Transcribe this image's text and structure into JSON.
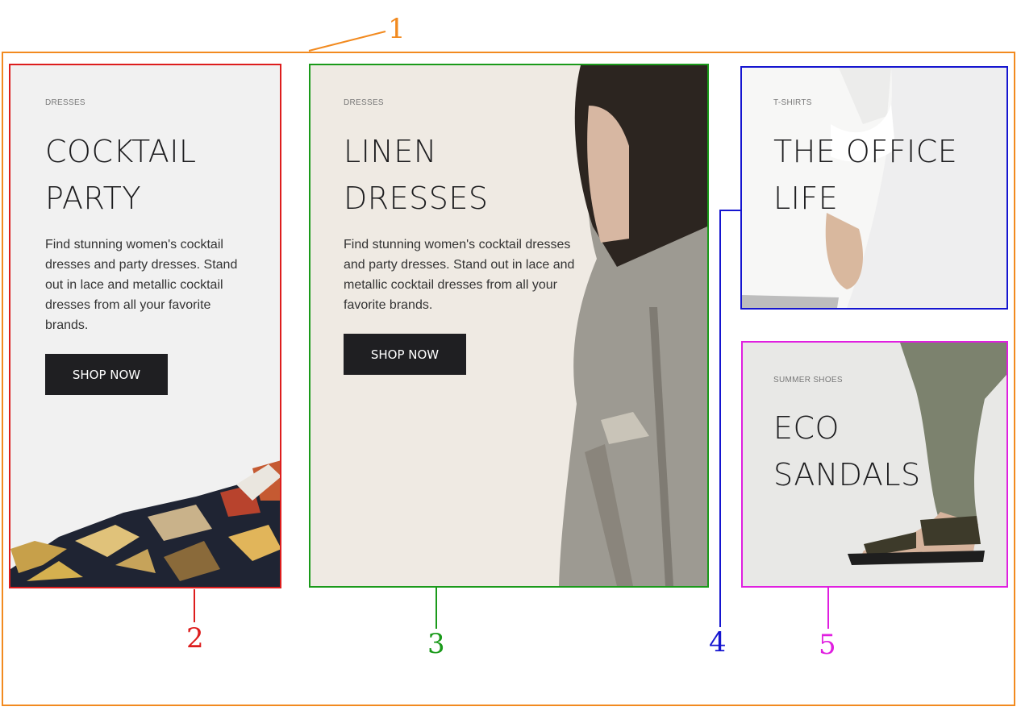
{
  "cards": [
    {
      "category": "DRESSES",
      "title_line1": "COCKTAIL",
      "title_line2": "PARTY",
      "description": "Find stunning women's cocktail dresses and party dresses. Stand out in lace and metallic cocktail dresses from all your favorite brands.",
      "button": "SHOP NOW"
    },
    {
      "category": "DRESSES",
      "title_line1": "LINEN",
      "title_line2": "DRESSES",
      "description": "Find stunning women's cocktail dresses and party dresses. Stand out in lace and metallic cocktail dresses from all your favorite brands.",
      "button": "SHOP NOW"
    },
    {
      "category": "T-SHIRTS",
      "title_line1": "THE OFFICE",
      "title_line2": "LIFE"
    },
    {
      "category": "SUMMER SHOES",
      "title_line1": "ECO",
      "title_line2": "SANDALS"
    }
  ],
  "annotations": {
    "labels": [
      "1",
      "2",
      "3",
      "4",
      "5"
    ],
    "colors": [
      "#f28a1f",
      "#dd1d1d",
      "#1a9a1a",
      "#1515d0",
      "#e01fe0"
    ]
  }
}
